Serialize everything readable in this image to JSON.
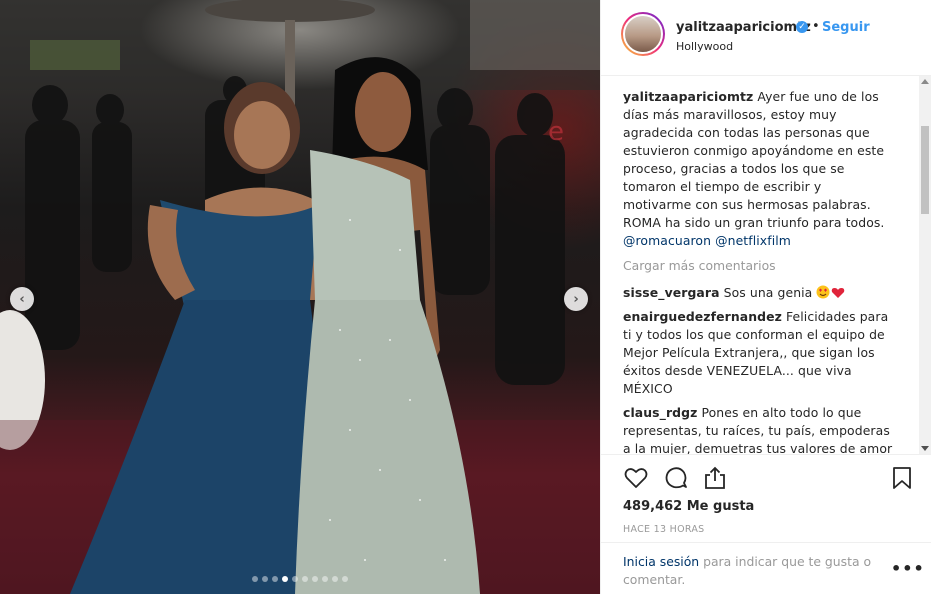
{
  "photo": {
    "prev_label": "‹",
    "next_label": "›",
    "slide_count": 10,
    "active_slide": 4
  },
  "header": {
    "username": "yalitzaaparicio mtz",
    "username_text": "yalitzaaparicio mtz",
    "verified_glyph": "✓",
    "separator": "•",
    "follow_label": "Seguir",
    "location": "Hollywood"
  },
  "caption": {
    "username": "yalitzaaparicio mtz",
    "text": "Ayer fue uno de los días más maravillosos, estoy muy agradecida con todas las personas que estuvieron conmigo apoyándome en este proceso, gracias a todos los que se tomaron el tiempo de escribir y motivarme con sus hermosas palabras.",
    "line2": "ROMA ha sido un gran triunfo para todos.",
    "mention1": "@romacuaron",
    "mention2": "@netflixfilm"
  },
  "load_more": "Cargar más comentarios",
  "comments": [
    {
      "username": "sisse_vergara",
      "text": "Sos una genia",
      "emoji": "😍❤️"
    },
    {
      "username": "enairguedezfernandez",
      "text": "Felicidades para ti y todos los que conforman el equipo de Mejor Película Extranjera,, que sigan los éxitos desde VENEZUELA... que viva MÉXICO"
    },
    {
      "username": "claus_rdgz",
      "text": "Pones en alto todo lo que representas, tu raíces, tu país, empoderas a la mujer, demuetras tus valores de amor y"
    }
  ],
  "actions": {
    "likes": "489,462 Me gusta",
    "time": "HACE 13 HORAS",
    "icons": [
      "heart-icon",
      "comment-icon",
      "share-icon",
      "bookmark-icon"
    ]
  },
  "login": {
    "link": "Inicia sesión",
    "text": " para indicar que te gusta o comentar.",
    "more": "•••"
  },
  "colors": {
    "link": "#003569",
    "accent": "#3897f0",
    "muted": "#999999",
    "text": "#262626"
  }
}
